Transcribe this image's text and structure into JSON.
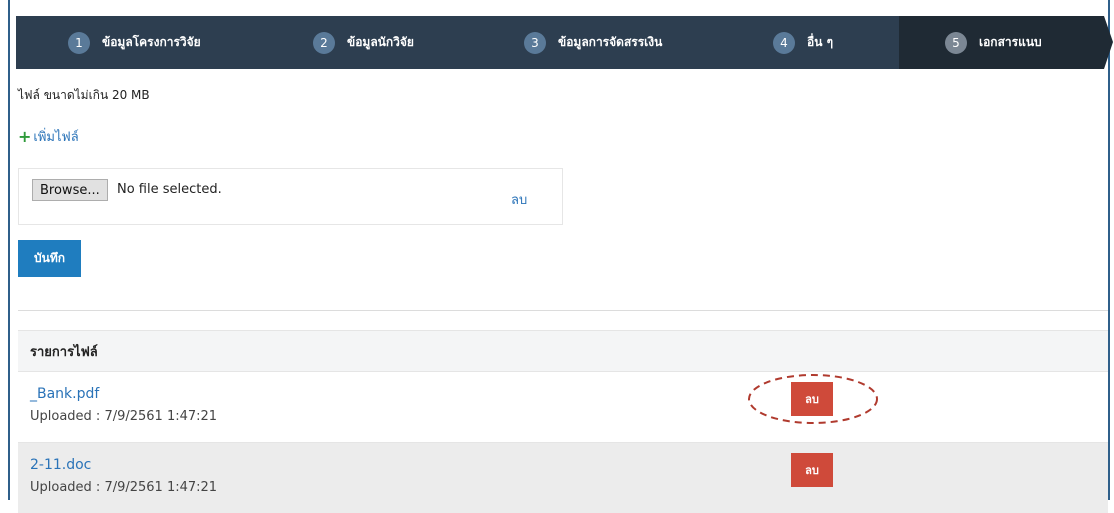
{
  "steps": [
    {
      "num": "1",
      "label": "ข้อมูลโครงการวิจัย"
    },
    {
      "num": "2",
      "label": "ข้อมูลนักวิจัย"
    },
    {
      "num": "3",
      "label": "ข้อมูลการจัดสรรเงิน"
    },
    {
      "num": "4",
      "label": "อื่น ๆ"
    },
    {
      "num": "5",
      "label": "เอกสารแนบ"
    }
  ],
  "active_step": "5",
  "note": "ไฟล์ ขนาดไม่เกิน 20 MB",
  "add_file": {
    "icon": "plus-icon",
    "label": "เพิ่มไฟล์"
  },
  "upload": {
    "browse_label": "Browse...",
    "status": "No file selected.",
    "remove_label": "ลบ"
  },
  "save_label": "บันทึก",
  "file_list": {
    "header": "รายการไฟล์",
    "files": [
      {
        "name": "_Bank.pdf",
        "uploaded": "Uploaded : 7/9/2561 1:47:21",
        "delete_label": "ลบ"
      },
      {
        "name": "2-11.doc",
        "uploaded": "Uploaded : 7/9/2561 1:47:21",
        "delete_label": "ลบ"
      }
    ]
  },
  "colors": {
    "nav_bg": "#2d3e50",
    "nav_active": "#1f2a34",
    "primary": "#1f7dbf",
    "danger": "#cf4a3a",
    "link": "#2a73b8",
    "annotation": "#b03a2e"
  }
}
